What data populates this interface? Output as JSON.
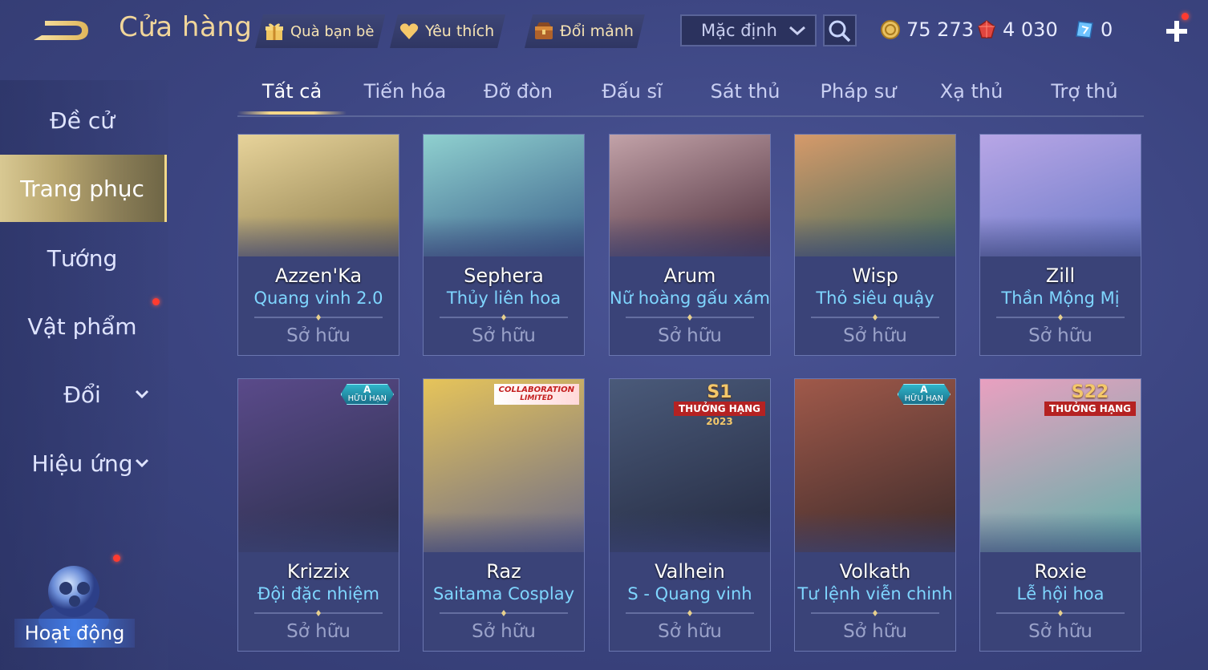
{
  "header": {
    "title": "Cửa hàng",
    "buttons": [
      {
        "label": "Quà bạn bè",
        "icon": "gift-icon"
      },
      {
        "label": "Yêu thích",
        "icon": "heart-icon"
      },
      {
        "label": "Đổi mảnh",
        "icon": "chest-icon"
      }
    ],
    "sort": {
      "value": "Mặc định"
    },
    "currencies": [
      {
        "value": "75 273",
        "icon": "gold-coin-icon",
        "color": "#e8c060"
      },
      {
        "value": "4 030",
        "icon": "red-gem-icon",
        "color": "#e0453f"
      },
      {
        "value": "0",
        "icon": "voucher-icon",
        "color": "#6ec3ff"
      }
    ]
  },
  "sidebar": {
    "items": [
      {
        "label": "Đề cử"
      },
      {
        "label": "Trang phục"
      },
      {
        "label": "Tướng"
      },
      {
        "label": "Vật phẩm"
      },
      {
        "label": "Đổi"
      },
      {
        "label": "Hiệu ứng"
      }
    ],
    "active": "Trang phục",
    "activity_label": "Hoạt động"
  },
  "tabs": [
    "Tất cả",
    "Tiến hóa",
    "Đỡ đòn",
    "Đấu sĩ",
    "Sát thủ",
    "Pháp sư",
    "Xạ thủ",
    "Trợ thủ"
  ],
  "active_tab": "Tất cả",
  "owned_label": "Sở hữu",
  "cards": [
    {
      "hero": "Azzen'Ka",
      "skin": "Quang vinh 2.0",
      "owned": "Sở hữu",
      "colors": [
        "#e7d39a",
        "#8a7a4a"
      ]
    },
    {
      "hero": "Sephera",
      "skin": "Thủy liên hoa",
      "owned": "Sở hữu",
      "colors": [
        "#8fd0cf",
        "#3a5f8a"
      ]
    },
    {
      "hero": "Arum",
      "skin": "Nữ hoàng gấu xám",
      "owned": "Sở hữu",
      "colors": [
        "#c2a2a8",
        "#4a2c3a"
      ]
    },
    {
      "hero": "Wisp",
      "skin": "Thỏ siêu quậy",
      "owned": "Sở hữu",
      "colors": [
        "#d69a6a",
        "#3f6a5a"
      ]
    },
    {
      "hero": "Zill",
      "skin": "Thần Mộng Mị",
      "owned": "Sở hữu",
      "colors": [
        "#b8a6e6",
        "#6a7ac8"
      ]
    },
    {
      "hero": "Krizzix",
      "skin": "Đội đặc nhiệm",
      "owned": "Sở hữu",
      "colors": [
        "#5a4a8a",
        "#2a2f4a"
      ],
      "badge": {
        "top": "A",
        "text": "HỮU HẠN"
      }
    },
    {
      "hero": "Raz",
      "skin": "Saitama Cosplay",
      "owned": "Sở hữu",
      "colors": [
        "#e6c45a",
        "#6a6a8a"
      ],
      "badge": {
        "text": "COLLABORATION",
        "sub": "LIMITED"
      }
    },
    {
      "hero": "Valhein",
      "skin": "S - Quang vinh",
      "owned": "Sở hữu",
      "colors": [
        "#4a5a7a",
        "#242a40"
      ],
      "badge": {
        "top": "S1",
        "text": "THƯỞNG HẠNG",
        "sub": "2023"
      }
    },
    {
      "hero": "Volkath",
      "skin": "Tư lệnh viễn chinh",
      "owned": "Sở hữu",
      "colors": [
        "#a0594a",
        "#3a2a2a"
      ],
      "badge": {
        "top": "A",
        "text": "HỮU HẠN"
      }
    },
    {
      "hero": "Roxie",
      "skin": "Lễ hội hoa",
      "owned": "Sở hữu",
      "colors": [
        "#e9a0c0",
        "#5fb0a8"
      ],
      "badge": {
        "top": "S22",
        "text": "THƯỞNG HẠNG"
      }
    }
  ]
}
